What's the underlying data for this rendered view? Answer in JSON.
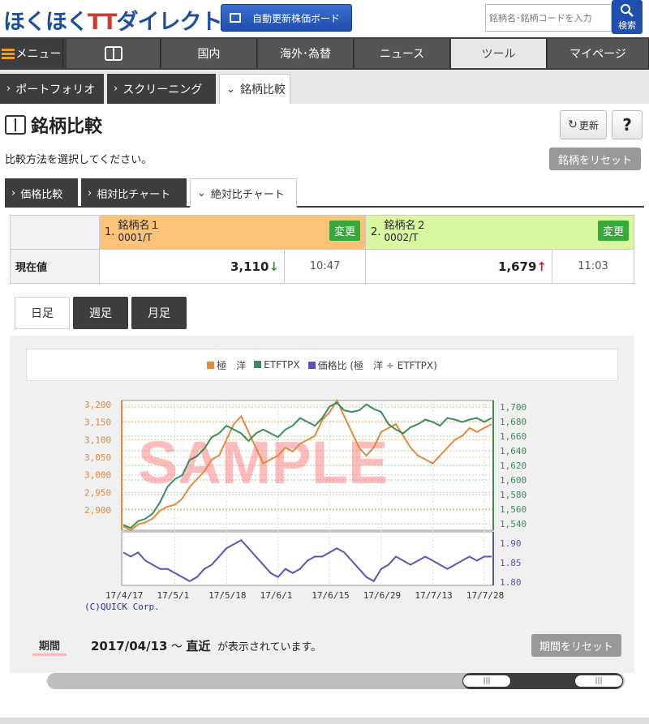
{
  "header": {
    "logo_main": "ほくほく",
    "logo_tt": "TT",
    "logo_sub": "ダイレクト",
    "auto_board": "自動更新株価ボード",
    "search_placeholder": "銘柄名･銘柄コードを入力",
    "search_label": "検索"
  },
  "nav": [
    "メニュー",
    "",
    "国内",
    "海外･為替",
    "ニュース",
    "ツール",
    "マイページ"
  ],
  "subnav": [
    "ポートフォリオ",
    "スクリーニング",
    "銘柄比較"
  ],
  "page": {
    "title": "銘柄比較",
    "refresh": "更新",
    "help": "?",
    "instruction": "比較方法を選択してください。",
    "reset": "銘柄をリセット"
  },
  "compare_tabs": [
    "価格比較",
    "相対比チャート",
    "絶対比チャート"
  ],
  "stocks": {
    "row_label": "現在値",
    "change_label": "変更",
    "items": [
      {
        "num": "1.",
        "name": "銘柄名１",
        "code": "0001/T",
        "price": "3,110",
        "arrow": "↓",
        "time": "10:47"
      },
      {
        "num": "2.",
        "name": "銘柄名２",
        "code": "0002/T",
        "price": "1,679",
        "arrow": "↑",
        "time": "11:03"
      }
    ]
  },
  "period_tabs": [
    "日足",
    "週足",
    "月足"
  ],
  "chart_legend": [
    "極　洋",
    "ETFTPX",
    "価格比 (極　洋 ÷ ETFTPX)"
  ],
  "colors": {
    "series1": "#e08a3c",
    "series2": "#3a8f58",
    "ratio": "#5555bb"
  },
  "watermark": "SAMPLE",
  "copyright": "(C)QUICK Corp.",
  "period": {
    "label": "期間",
    "start": "2017/04/13",
    "tilde": "～",
    "end": "直近",
    "suffix": "が表示されています。",
    "reset": "期間をリセット"
  },
  "chart_data": {
    "type": "line",
    "x": [
      "17/4/17",
      "17/5/1",
      "17/5/18",
      "17/6/1",
      "17/6/15",
      "17/6/29",
      "17/7/13",
      "17/7/28"
    ],
    "left_axis_ticks": [
      "3,200",
      "3,150",
      "3,100",
      "3,050",
      "3,000",
      "2,950",
      "2,900"
    ],
    "right_axis_ticks": [
      "1,700",
      "1,680",
      "1,660",
      "1,640",
      "1,620",
      "1,600",
      "1,580",
      "1,560",
      "1,540"
    ],
    "ratio_axis_ticks": [
      "1.90",
      "1.85",
      "1.80"
    ],
    "ylim_left": [
      2870,
      3200
    ],
    "ylim_right": [
      1533,
      1703
    ],
    "ylim_ratio": [
      1.79,
      1.92
    ],
    "series": [
      {
        "name": "極　洋",
        "axis": "left",
        "values": [
          2880,
          2870,
          2885,
          2890,
          2900,
          2920,
          2930,
          2935,
          2950,
          2980,
          3000,
          3020,
          3050,
          3060,
          3100,
          3140,
          3160,
          3120,
          3080,
          3040,
          3050,
          3060,
          3080,
          3070,
          3090,
          3100,
          3110,
          3150,
          3170,
          3200,
          3160,
          3120,
          3080,
          3060,
          3080,
          3120,
          3130,
          3140,
          3110,
          3080,
          3060,
          3050,
          3040,
          3060,
          3080,
          3100,
          3110,
          3130,
          3120,
          3130,
          3140
        ]
      },
      {
        "name": "ETFTPX",
        "axis": "right",
        "values": [
          1540,
          1536,
          1545,
          1548,
          1555,
          1570,
          1590,
          1600,
          1605,
          1625,
          1630,
          1640,
          1655,
          1660,
          1670,
          1665,
          1660,
          1650,
          1660,
          1665,
          1660,
          1655,
          1665,
          1670,
          1680,
          1675,
          1670,
          1680,
          1695,
          1700,
          1690,
          1688,
          1690,
          1698,
          1692,
          1688,
          1672,
          1665,
          1660,
          1668,
          1672,
          1678,
          1675,
          1670,
          1680,
          1678,
          1675,
          1678,
          1680,
          1675,
          1680
        ]
      },
      {
        "name": "価格比",
        "axis": "ratio",
        "values": [
          1.87,
          1.86,
          1.87,
          1.85,
          1.84,
          1.83,
          1.83,
          1.82,
          1.81,
          1.8,
          1.81,
          1.83,
          1.84,
          1.86,
          1.88,
          1.89,
          1.9,
          1.88,
          1.86,
          1.84,
          1.82,
          1.81,
          1.83,
          1.82,
          1.83,
          1.85,
          1.86,
          1.86,
          1.87,
          1.88,
          1.87,
          1.85,
          1.83,
          1.81,
          1.8,
          1.83,
          1.84,
          1.86,
          1.85,
          1.84,
          1.85,
          1.86,
          1.85,
          1.84,
          1.83,
          1.84,
          1.85,
          1.86,
          1.85,
          1.86,
          1.86
        ]
      }
    ]
  }
}
